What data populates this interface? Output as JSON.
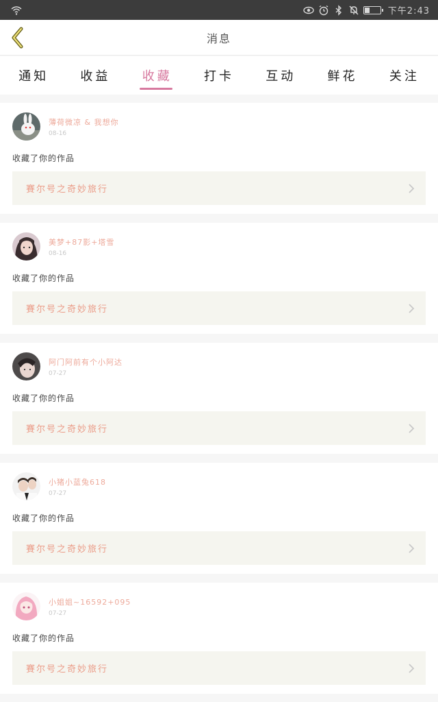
{
  "status_bar": {
    "time": "下午2:43"
  },
  "header": {
    "title": "消息"
  },
  "tabs": [
    {
      "label": "通知",
      "active": false
    },
    {
      "label": "收益",
      "active": false
    },
    {
      "label": "收藏",
      "active": true
    },
    {
      "label": "打卡",
      "active": false
    },
    {
      "label": "互动",
      "active": false
    },
    {
      "label": "鲜花",
      "active": false
    },
    {
      "label": "关注",
      "active": false
    }
  ],
  "notifications": [
    {
      "user": "薄荷微凉 & 我想你",
      "date": "08-16",
      "action": "收藏了你的作品",
      "work": "賽尔号之奇妙旅行"
    },
    {
      "user": "美梦+87影+塔雪",
      "date": "08-16",
      "action": "收藏了你的作品",
      "work": "賽尔号之奇妙旅行"
    },
    {
      "user": "阿门阿前有个小阿达",
      "date": "07-27",
      "action": "收藏了你的作品",
      "work": "賽尔号之奇妙旅行"
    },
    {
      "user": "小猪小蓝兔618",
      "date": "07-27",
      "action": "收藏了你的作品",
      "work": "賽尔号之奇妙旅行"
    },
    {
      "user": "小姐姐~16592+095",
      "date": "07-27",
      "action": "收藏了你的作品",
      "work": "賽尔号之奇妙旅行"
    }
  ],
  "colors": {
    "accent": "#d7799f",
    "username": "#eda99a",
    "work_title": "#eb9c88",
    "work_bg": "#f5f5ef"
  }
}
